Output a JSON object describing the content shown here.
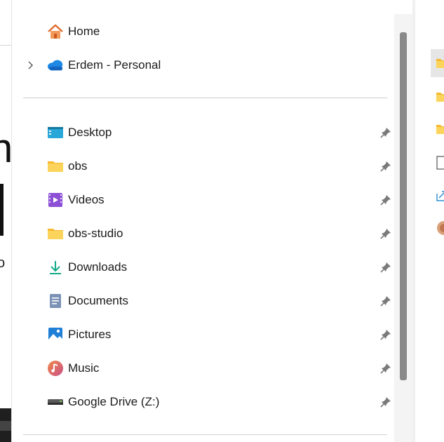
{
  "navigation": {
    "top_items": [
      {
        "label": "Home",
        "icon": "home-icon",
        "expandable": false
      },
      {
        "label": "Erdem - Personal",
        "icon": "onedrive-cloud-icon",
        "expandable": true
      }
    ],
    "quick_access": [
      {
        "label": "Desktop",
        "icon": "desktop-icon",
        "pinned": true
      },
      {
        "label": "obs",
        "icon": "folder-icon",
        "pinned": true
      },
      {
        "label": "Videos",
        "icon": "videos-icon",
        "pinned": true
      },
      {
        "label": "obs-studio",
        "icon": "folder-icon",
        "pinned": true
      },
      {
        "label": "Downloads",
        "icon": "downloads-icon",
        "pinned": true
      },
      {
        "label": "Documents",
        "icon": "documents-icon",
        "pinned": true
      },
      {
        "label": "Pictures",
        "icon": "pictures-icon",
        "pinned": true
      },
      {
        "label": "Music",
        "icon": "music-icon",
        "pinned": true
      },
      {
        "label": "Google Drive (Z:)",
        "icon": "drive-icon",
        "pinned": true
      }
    ]
  },
  "colors": {
    "folder_yellow": "#f8c948",
    "accent_blue": "#1a73e8",
    "scrollbar_thumb": "#8a8a8a"
  }
}
